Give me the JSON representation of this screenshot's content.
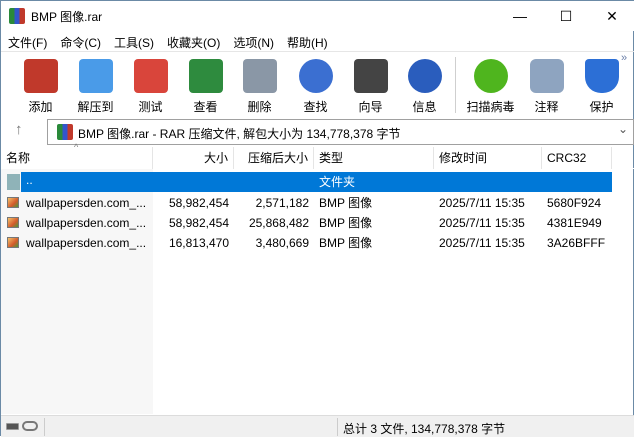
{
  "window": {
    "title": "BMP 图像.rar",
    "minimize": "—",
    "maximize": "☐",
    "close": "✕"
  },
  "menu": [
    "文件(F)",
    "命令(C)",
    "工具(S)",
    "收藏夹(O)",
    "选项(N)",
    "帮助(H)"
  ],
  "toolbar": [
    {
      "label": "添加",
      "icon": "add-archive-icon",
      "color": "#c0392b"
    },
    {
      "label": "解压到",
      "icon": "extract-folder-icon",
      "color": "#4a9be8"
    },
    {
      "label": "测试",
      "icon": "test-clipboard-icon",
      "color": "#d9453b"
    },
    {
      "label": "查看",
      "icon": "view-book-icon",
      "color": "#2e8b3e"
    },
    {
      "label": "删除",
      "icon": "trash-icon",
      "color": "#8a97a6"
    },
    {
      "label": "查找",
      "icon": "find-magnifier-icon",
      "color": "#3b6fd1"
    },
    {
      "label": "向导",
      "icon": "wizard-wand-icon",
      "color": "#444444"
    },
    {
      "label": "信息",
      "icon": "info-icon",
      "color": "#2a5dbd"
    },
    {
      "label": "扫描病毒",
      "icon": "virus-scan-icon",
      "color": "#4fb51e"
    },
    {
      "label": "注释",
      "icon": "comment-icon",
      "color": "#8ea4c0"
    },
    {
      "label": "保护",
      "icon": "protect-shield-icon",
      "color": "#2c6fd6"
    }
  ],
  "overflow": "»",
  "address": {
    "text": "BMP 图像.rar - RAR 压缩文件, 解包大小为 134,778,378 字节",
    "up": "↑",
    "dropdown": "⌄"
  },
  "columns": [
    "名称",
    "大小",
    "压缩后大小",
    "类型",
    "修改时间",
    "CRC32"
  ],
  "parent_row": {
    "name": "..",
    "type": "文件夹"
  },
  "files": [
    {
      "name": "wallpapersden.com_...",
      "size": "58,982,454",
      "packed": "2,571,182",
      "type": "BMP 图像",
      "modified": "2025/7/11 15:35",
      "crc": "5680F924"
    },
    {
      "name": "wallpapersden.com_...",
      "size": "58,982,454",
      "packed": "25,868,482",
      "type": "BMP 图像",
      "modified": "2025/7/11 15:35",
      "crc": "4381E949"
    },
    {
      "name": "wallpapersden.com_...",
      "size": "16,813,470",
      "packed": "3,480,669",
      "type": "BMP 图像",
      "modified": "2025/7/11 15:35",
      "crc": "3A26BFFF"
    }
  ],
  "status": {
    "total": "总计 3 文件, 134,778,378 字节"
  },
  "colors": {
    "selection": "#0078d7"
  }
}
